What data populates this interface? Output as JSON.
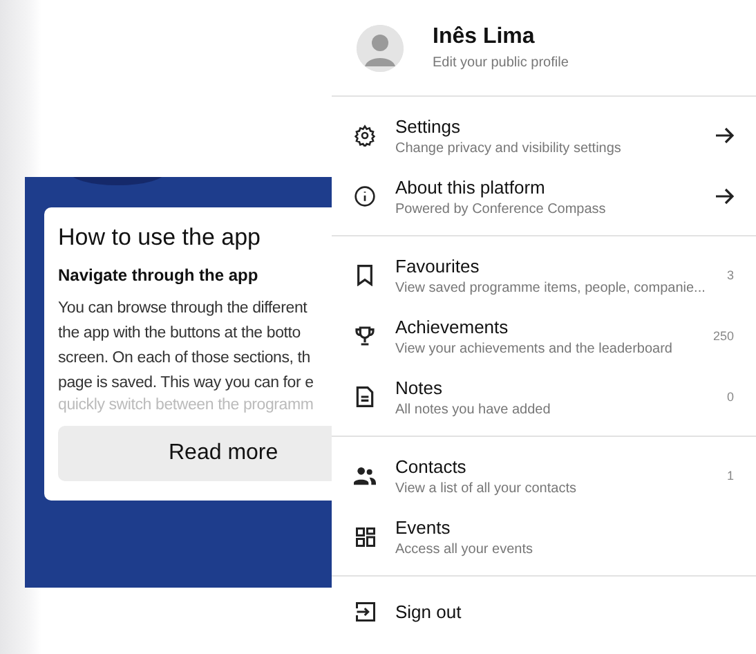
{
  "background_card": {
    "title": "How to use the app",
    "subtitle": "Navigate through the app",
    "body_lines": [
      "You can browse through the different",
      "the app with the buttons at the botto",
      "screen. On each of those sections, th",
      "page is saved. This way you can for e",
      "quickly switch between the programm"
    ],
    "button": "Read more"
  },
  "menu": {
    "profile": {
      "name": "Inês Lima",
      "subtitle": "Edit your public profile"
    },
    "groups": [
      [
        {
          "kind": "link",
          "title": "Settings",
          "subtitle": "Change privacy and visibility settings"
        },
        {
          "kind": "link",
          "title": "About this platform",
          "subtitle": "Powered by Conference Compass"
        }
      ],
      [
        {
          "kind": "counter",
          "title": "Favourites",
          "subtitle": "View saved programme items, people, companie...",
          "count": "3"
        },
        {
          "kind": "counter",
          "title": "Achievements",
          "subtitle": "View your achievements and the leaderboard",
          "count": "250"
        },
        {
          "kind": "counter",
          "title": "Notes",
          "subtitle": "All notes you have added",
          "count": "0"
        }
      ],
      [
        {
          "kind": "counter",
          "title": "Contacts",
          "subtitle": "View a list of all your contacts",
          "count": "1"
        },
        {
          "kind": "plain",
          "title": "Events",
          "subtitle": "Access all your events"
        }
      ],
      [
        {
          "kind": "plain",
          "title": "Sign out"
        }
      ]
    ]
  }
}
